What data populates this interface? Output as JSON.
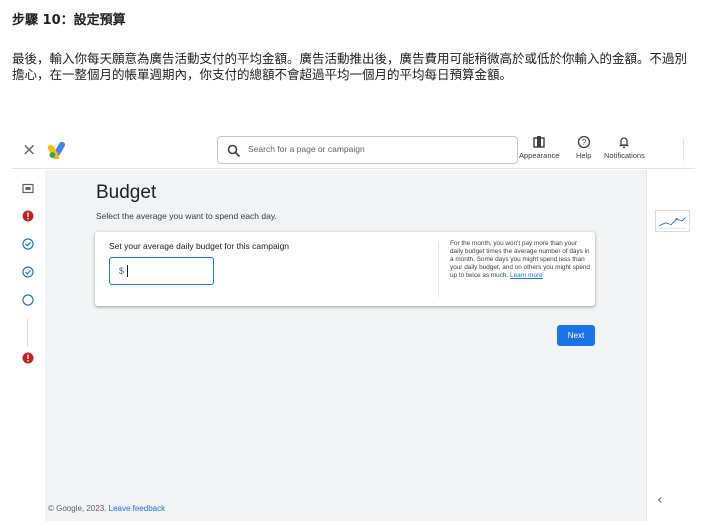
{
  "step": {
    "title": "步驟 10：設定預算",
    "description": "最後，輸入你每天願意為廣告活動支付的平均金額。廣告活動推出後，廣告費用可能稍微高於或低於你輸入的金額。不過別擔心，在一整個月的帳單週期內，你支付的總額不會超過平均一個月的平均每日預算金額。"
  },
  "topbar": {
    "close_glyph": "×",
    "logo": "google-ads-logo",
    "search_placeholder": "Search for a page or campaign",
    "tools": [
      {
        "label": "Appearance",
        "icon": "appearance-icon"
      },
      {
        "label": "Help",
        "icon": "help-icon"
      },
      {
        "label": "Notifications",
        "icon": "bell-icon"
      }
    ]
  },
  "rail": {
    "steps": [
      {
        "icon": "preview-icon"
      },
      {
        "icon": "error-icon",
        "color": "#c5221f"
      },
      {
        "icon": "check-circle-icon",
        "color": "#1a73e8"
      },
      {
        "icon": "check-circle-icon",
        "color": "#1a73e8"
      },
      {
        "icon": "empty-circle-icon",
        "color": "#1a73e8"
      },
      {
        "icon": "error-icon",
        "color": "#c5221f"
      }
    ]
  },
  "main": {
    "title": "Budget",
    "subtitle": "Select the average you want to spend each day.",
    "card": {
      "label": "Set your average daily budget for this campaign",
      "input_prefix": "$",
      "input_value": "",
      "help_text": "For the month, you won't pay more than your daily budget times the average number of days in a month. Some days you might spend less than your daily budget, and on others you might spend up to twice as much.",
      "help_link": "Learn more"
    },
    "next_label": "Next",
    "footer_text": "© Google, 2023.",
    "footer_link": "Leave feedback"
  },
  "right_panel": {
    "thumbnail": "chart-thumbnail",
    "collapse_glyph": "‹"
  },
  "colors": {
    "accent": "#1a73e8",
    "error": "#c5221f",
    "background": "#f1f3f4"
  }
}
